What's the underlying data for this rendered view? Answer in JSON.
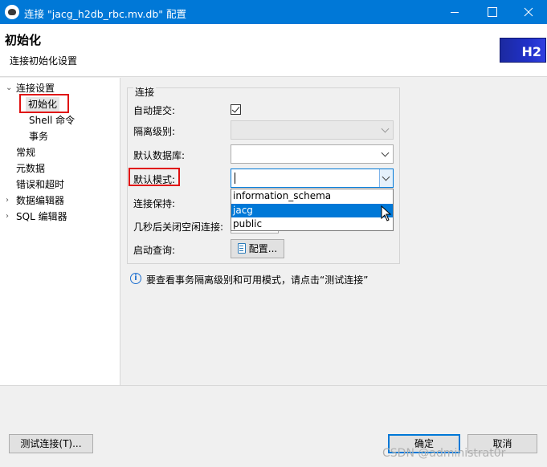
{
  "window": {
    "title": "连接 \"jacg_h2db_rbc.mv.db\" 配置"
  },
  "header": {
    "title": "初始化",
    "subtitle": "连接初始化设置",
    "logo_text": "H2"
  },
  "nav": {
    "items": [
      {
        "label": "连接设置",
        "expander": "⌄",
        "level": 0
      },
      {
        "label": "初始化",
        "level": 1,
        "selected": true
      },
      {
        "label": "Shell 命令",
        "level": 1
      },
      {
        "label": "事务",
        "level": 1
      },
      {
        "label": "常规",
        "level": 0
      },
      {
        "label": "元数据",
        "level": 0
      },
      {
        "label": "错误和超时",
        "level": 0
      },
      {
        "label": "数据编辑器",
        "expander": "›",
        "level": 0
      },
      {
        "label": "SQL 编辑器",
        "expander": "›",
        "level": 0
      }
    ]
  },
  "form": {
    "group_label": "连接",
    "auto_commit_label": "自动提交:",
    "auto_commit_checked": true,
    "isolation_label": "隔离级别:",
    "isolation_value": "",
    "default_db_label": "默认数据库:",
    "default_db_value": "",
    "default_schema_label": "默认模式:",
    "default_schema_value": "",
    "keepalive_label": "连接保持:",
    "idle_close_label": "几秒后关闭空闲连接:",
    "startup_query_label": "启动查询:",
    "configure_button": "配置..."
  },
  "schema_dropdown": {
    "options": [
      "information_schema",
      "jacg",
      "public"
    ],
    "highlighted": "jacg"
  },
  "info": {
    "icon": "info-icon",
    "text": "要查看事务隔离级别和可用模式，请点击“测试连接”"
  },
  "footer": {
    "test_button": "测试连接(T)...",
    "ok_button": "确定",
    "cancel_button": "取消"
  },
  "watermark": "CSDN @administrat0r",
  "colors": {
    "titlebar": "#0078d7",
    "selection": "#0078d7",
    "highlight_box": "#e01010"
  }
}
